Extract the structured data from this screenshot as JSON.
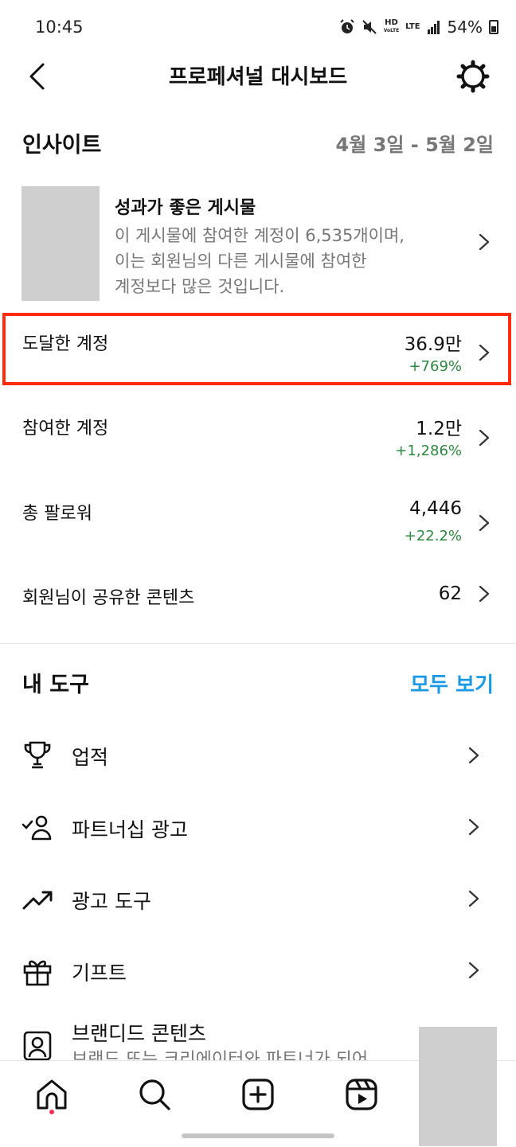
{
  "status": {
    "time": "10:45",
    "hd": "HD",
    "hd_sub": "VoLTE",
    "lte": "LTE",
    "battery": "54%"
  },
  "header": {
    "title": "프로페셔널 대시보드"
  },
  "insights": {
    "title": "인사이트",
    "date_range": "4월 3일 - 5월 2일",
    "top_post": {
      "title": "성과가 좋은 게시물",
      "desc_line1": "이 게시물에 참여한 계정이 6,535개이며,",
      "desc_line2": "이는 회원님의 다른 게시물에 참여한",
      "desc_line3": "계정보다 많은 것입니다."
    },
    "metrics": [
      {
        "label": "도달한 계정",
        "value": "36.9만",
        "change": "+769%"
      },
      {
        "label": "참여한 계정",
        "value": "1.2만",
        "change": "+1,286%"
      },
      {
        "label": "총 팔로워",
        "value": "4,446",
        "change": "+22.2%"
      },
      {
        "label": "회원님이 공유한 콘텐츠",
        "value": "62",
        "change": ""
      }
    ]
  },
  "tools": {
    "title": "내 도구",
    "see_all": "모두 보기",
    "items": [
      {
        "label": "업적",
        "icon": "trophy-icon"
      },
      {
        "label": "파트너십 광고",
        "icon": "partner-icon"
      },
      {
        "label": "광고 도구",
        "icon": "trending-icon"
      },
      {
        "label": "기프트",
        "icon": "gift-icon"
      },
      {
        "label": "브랜디드 콘텐츠",
        "icon": "branded-content-icon",
        "sub": "브랜드 또는 크리에이터와 파트너가 되어"
      }
    ]
  },
  "colors": {
    "positive": "#2a8a3e",
    "accent": "#1a9ae6",
    "highlight": "#ff2d0d",
    "muted": "#777777"
  }
}
